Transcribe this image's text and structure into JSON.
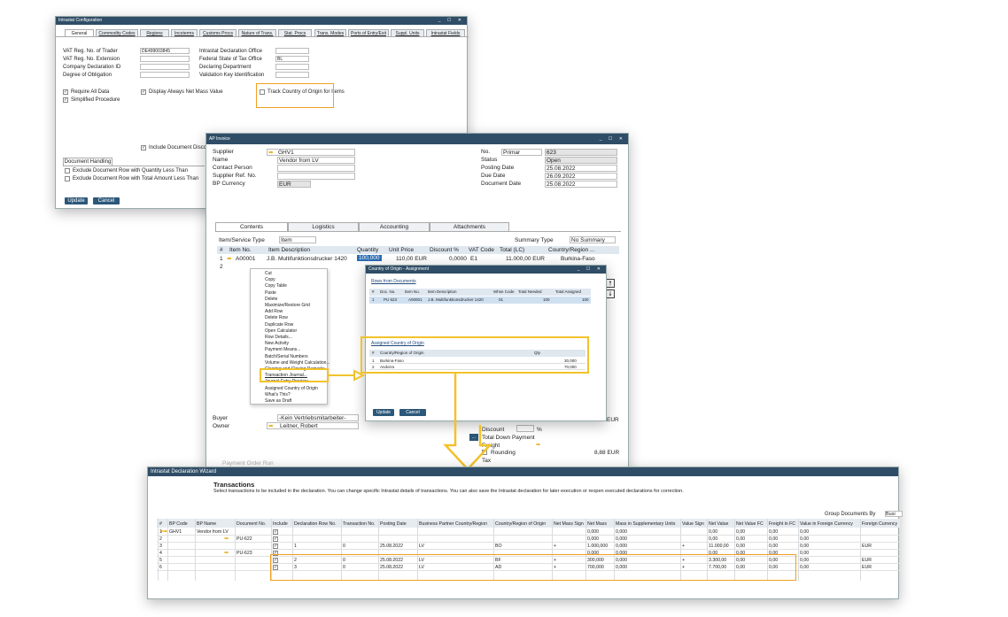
{
  "intrastat_config": {
    "title": "Intrastat Configuration",
    "tabs": [
      "General",
      "Commodity Codes",
      "Regions",
      "Incoterms",
      "Customs Procs",
      "Nature of Trans.",
      "Stat. Procs",
      "Trans. Modes",
      "Ports of Entry/Exit",
      "Suppl. Units",
      "Intrastat Fields"
    ],
    "left_labels": [
      "VAT Reg. No. of Trader",
      "VAT Reg. No. Extension",
      "Company Declaration ID",
      "Degree of Obligation"
    ],
    "vat_value": "DE499003845",
    "right_labels": [
      "Intrastat Declaration Office",
      "Federal State of Tax Office",
      "Declaring Department",
      "Validation Key Identification"
    ],
    "federal_value": "BL",
    "checks": [
      "Require All Data",
      "Simplified Procedure",
      "Display Always Net Mass Value",
      "Track Country of Origin for Items",
      "Include Document Discount for"
    ],
    "doc_handling": "Document Handling",
    "exclude_qty": "Exclude Document Row with Quantity Less Than",
    "exclude_total": "Exclude Document Row with Total Amount Less Than",
    "update": "Update",
    "cancel": "Cancel"
  },
  "ap_invoice": {
    "title": "AP Invoice",
    "labels": {
      "supplier": "Supplier",
      "name": "Name",
      "contact": "Contact Person",
      "ref": "Supplier Ref. No.",
      "currency": "BP Currency"
    },
    "supplier": "GHV1",
    "name": "Vendor from LV",
    "currency": "EUR",
    "right_labels": {
      "no": "No.",
      "status": "Status",
      "posting": "Posting Date",
      "due": "Due Date",
      "docdate": "Document Date"
    },
    "series": "Primar",
    "number": "623",
    "status": "Open",
    "posting": "25.08.2022",
    "due": "26.09.2022",
    "docdate": "25.08.2022",
    "tabs": [
      "Contents",
      "Logistics",
      "Accounting",
      "Attachments"
    ],
    "item_type_label": "Item/Service Type",
    "item_type": "Item",
    "summary_label": "Summary Type",
    "summary": "No Summary",
    "cols": [
      "#",
      "Item No.",
      "Item Description",
      "Quantity",
      "Unit Price",
      "Discount %",
      "VAT Code",
      "Total (LC)",
      "Country/Region ..."
    ],
    "row": {
      "n": "1",
      "item": "A00001",
      "desc": "J.B. Multifunktionsdrucker 1420",
      "qty": "100,000",
      "price": "110,00 EUR",
      "disc": "0,0000",
      "vat": "E1",
      "total": "11.000,00 EUR",
      "country": "Burkina-Faso"
    },
    "row2": "2",
    "buyer_label": "Buyer",
    "buyer": "-Kein Vertriebsmitarbeiter-",
    "owner_label": "Owner",
    "owner": "Leitner, Robert",
    "discount_label": "Discount",
    "pct": "%",
    "total_down": "Total Down Payment",
    "freight": "Freight",
    "rounding": "Rounding",
    "rounding_val": "8,88 EUR",
    "tax": "Tax",
    "eur": "EUR",
    "partial": "Payment Order Run"
  },
  "context_menu": [
    "Cut",
    "Copy",
    "Copy Table",
    "Paste",
    "Delete",
    "Maximize/Restore Grid",
    "Add Row",
    "Delete Row",
    "Duplicate Row",
    "Open Calculator",
    "Row Details...",
    "New Activity",
    "Payment Means...",
    "Batch/Serial Numbers",
    "Volume and Weight Calculation...",
    "Clearing and Closing Remarks",
    "Transaction Journal...",
    "Journal Entry Preview",
    "Assigned Country of Origin",
    "What's This?",
    "Save as Draft"
  ],
  "coo_dialog": {
    "title": "Country of Origin - Assignment",
    "rows_title": "Rows from Documents",
    "cols": [
      "#",
      "Doc. No.",
      "Item No.",
      "Item Description",
      "Whse Code",
      "Total Needed",
      "Total Assigned"
    ],
    "row": [
      "1",
      "PU 623",
      "A00001",
      "J.B. Multifunktionsdrucker 1420",
      "01",
      "100",
      "100"
    ],
    "assigned_title": "Assigned Country of Origin",
    "acols": [
      "#",
      "Country/Region of Origin",
      "Qty"
    ],
    "arows": [
      [
        "1",
        "Burkina-Faso",
        "30,000"
      ],
      [
        "2",
        "Andorra",
        "70,000"
      ]
    ],
    "update": "Update",
    "cancel": "Cancel"
  },
  "wizard": {
    "title": "Intrastat Declaration Wizard",
    "heading": "Transactions",
    "desc": "Select transactions to be included in the declaration. You can change specific Intrastat details of transactions. You can also save the Intrastat declaration for later execution or reopen executed declarations for correction.",
    "group_label": "Group Documents By",
    "group_value": "Busi",
    "cols": [
      "#",
      "BP Code",
      "BP Name",
      "Document No.",
      "Include",
      "Declaration Row No.",
      "Transaction No.",
      "Posting Date",
      "Business Partner Country/Region",
      "Country/Region of Origin",
      "Net Mass Sign",
      "Net Mass",
      "Mass in Supplementary Units",
      "Value Sign",
      "Net Value",
      "Net Value FC",
      "Freight in FC",
      "Value in Foreign Currency",
      "Foreign Currency"
    ],
    "rows": [
      [
        "1",
        "GHV1",
        "Vendor from LV",
        "",
        "✓",
        "",
        "",
        "",
        "",
        "",
        "",
        "0,000",
        "0,000",
        "",
        "0,00",
        "0,00",
        "0,00",
        "0,00",
        ""
      ],
      [
        "2",
        "",
        "",
        "PU-622",
        "✓",
        "",
        "",
        "",
        "",
        "",
        "",
        "0,000",
        "0,000",
        "",
        "0,00",
        "0,00",
        "0,00",
        "0,00",
        ""
      ],
      [
        "3",
        "",
        "",
        "",
        "✓",
        "1",
        "0",
        "25.08.2022",
        "LV",
        "BO",
        "+",
        "1.000,000",
        "0,000",
        "+",
        "11.000,00",
        "0,00",
        "0,00",
        "0,00",
        "EUR"
      ],
      [
        "4",
        "",
        "",
        "PU-623",
        "✓",
        "",
        "",
        "",
        "",
        "",
        "",
        "0,000",
        "0,000",
        "",
        "0,00",
        "0,00",
        "0,00",
        "0,00",
        ""
      ],
      [
        "5",
        "",
        "",
        "",
        "✓",
        "2",
        "0",
        "25.08.2022",
        "LV",
        "BF",
        "+",
        "300,000",
        "0,000",
        "+",
        "3.300,00",
        "0,00",
        "0,00",
        "0,00",
        "EUR"
      ],
      [
        "6",
        "",
        "",
        "",
        "✓",
        "3",
        "0",
        "25.08.2022",
        "LV",
        "AD",
        "+",
        "700,000",
        "0,000",
        "+",
        "7.700,00",
        "0,00",
        "0,00",
        "0,00",
        "EUR"
      ]
    ]
  }
}
